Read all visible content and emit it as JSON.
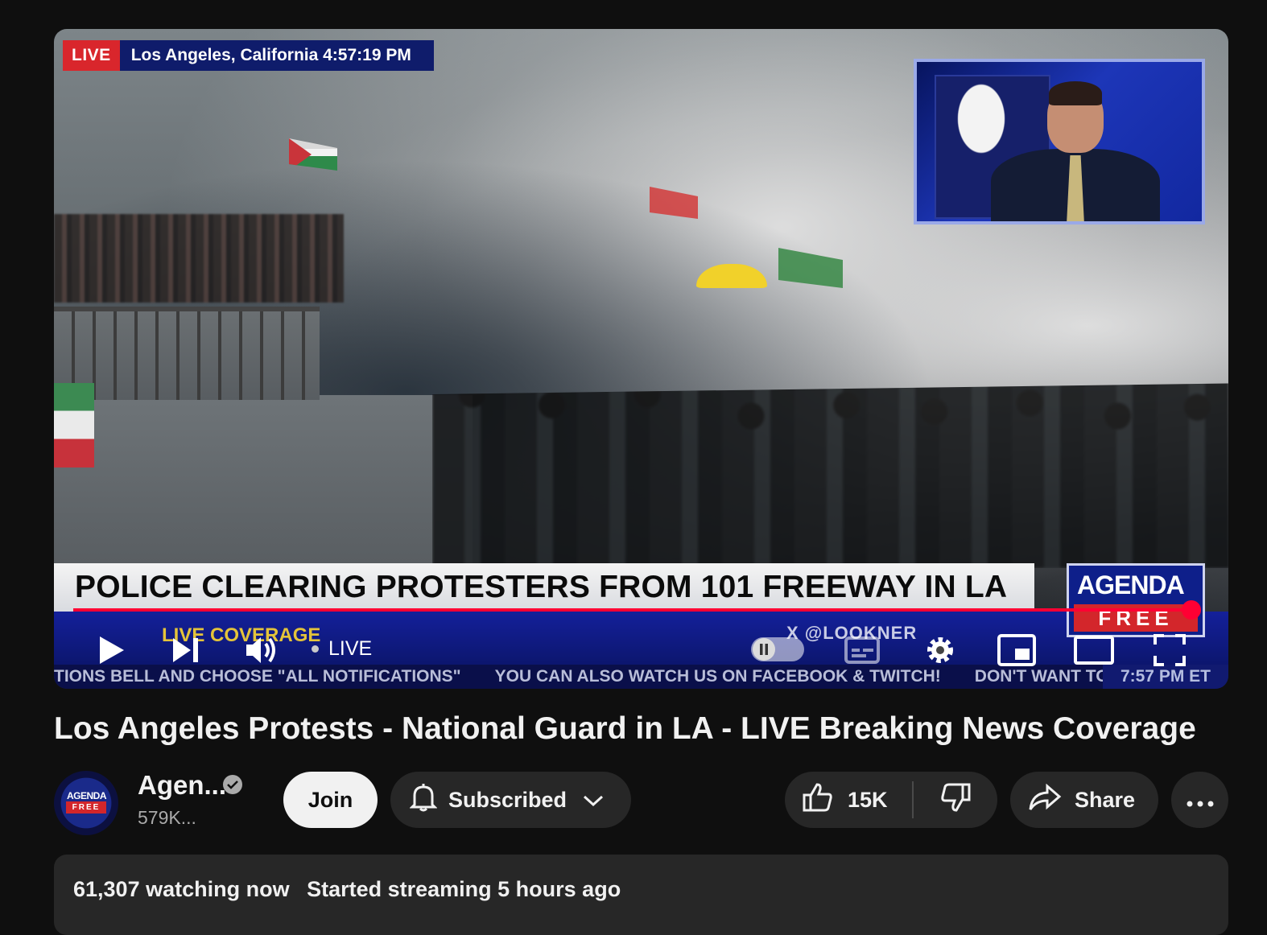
{
  "player": {
    "live_badge": "LIVE",
    "location_time": "Los Angeles, California 4:57:19 PM",
    "headline": "POLICE CLEARING PROTESTERS FROM 101 FREEWAY IN LA",
    "coverage_label": "LIVE COVERAGE",
    "social_handle": "X @LOOKNER",
    "ticker_items": [
      "TIONS BELL AND CHOOSE \"ALL NOTIFICATIONS\"",
      "YOU CAN ALSO WATCH US ON FACEBOOK & TWITCH!",
      "DON'T WANT TO MISS"
    ],
    "ticker_clock": "7:57 PM ET",
    "brand_logo_top": "AGENDA",
    "brand_logo_bottom": "FREE",
    "progress_fraction": 0.985,
    "live_label": "LIVE",
    "controls": {
      "play_icon": "play-icon",
      "next_icon": "next-icon",
      "volume_icon": "volume-icon",
      "autoplay_icon": "pause-icon",
      "captions_icon": "captions-icon",
      "settings_icon": "gear-icon",
      "miniplayer_icon": "miniplayer-icon",
      "theater_icon": "theater-icon",
      "fullscreen_icon": "fullscreen-icon"
    },
    "accent_color": "#ff0033"
  },
  "video": {
    "title": "Los Angeles Protests - National Guard in LA - LIVE Breaking News Coverage"
  },
  "channel": {
    "name": "Agen...",
    "subscribers": "579K...",
    "avatar_top": "AGENDA",
    "avatar_bottom": "FREE",
    "join_label": "Join",
    "subscribed_label": "Subscribed"
  },
  "actions": {
    "likes": "15K",
    "share_label": "Share"
  },
  "description": {
    "watching": "61,307 watching now",
    "started": "Started streaming 5 hours ago"
  }
}
